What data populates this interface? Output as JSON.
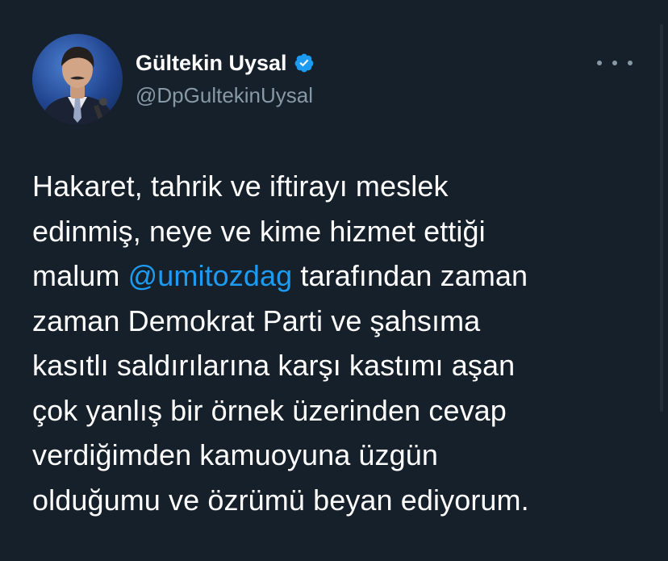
{
  "tweet": {
    "author": {
      "display_name": "Gültekin Uysal",
      "handle": "@DpGultekinUysal",
      "verified": true,
      "avatar_icon": "profile-photo-icon",
      "verified_icon": "verified-badge-icon"
    },
    "more_icon": "more-options-icon",
    "text_lines": {
      "l1": "Hakaret, tahrik ve iftirayı meslek",
      "l2": "edinmiş, neye ve kime hizmet ettiği",
      "l3_pre": "malum ",
      "l3_mention": "@umitozdag",
      "l3_post": " tarafından zaman",
      "l4": "zaman Demokrat Parti ve şahsıma",
      "l5": "kasıtlı saldırılarına karşı kastımı aşan",
      "l6": "çok yanlış bir örnek üzerinden cevap",
      "l7": "verdiğimden kamuoyuna üzgün",
      "l8": "olduğumu ve özrümü beyan ediyorum."
    }
  },
  "colors": {
    "background": "#15202b",
    "text": "#ffffff",
    "secondary": "#8899a6",
    "mention": "#1d9bf0",
    "verified": "#1d9bf0"
  }
}
